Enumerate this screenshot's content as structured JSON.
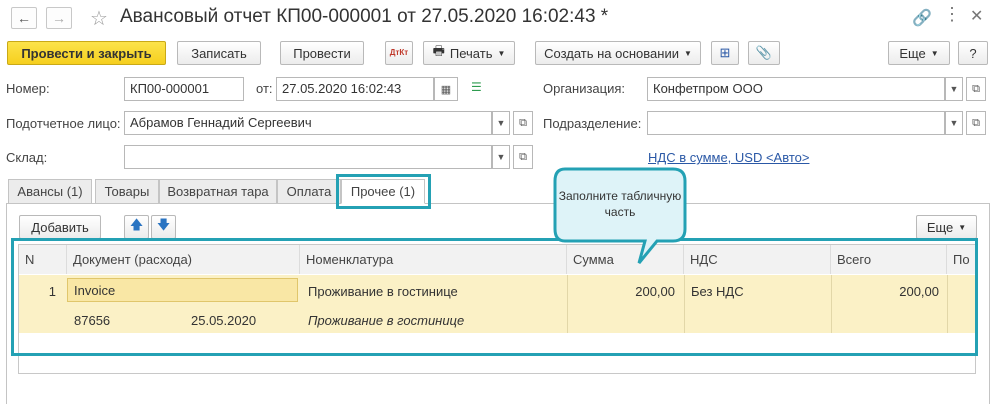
{
  "title": "Авансовый отчет КП00-000001 от 27.05.2020 16:02:43 *",
  "toolbar": {
    "post_close": "Провести и закрыть",
    "save": "Записать",
    "post": "Провести",
    "dt_kt": "ДтКт",
    "print": "Печать",
    "create_based": "Создать на основании",
    "more": "Еще",
    "help": "?"
  },
  "form": {
    "number_label": "Номер:",
    "number_value": "КП00-000001",
    "date_label": "от:",
    "date_value": "27.05.2020 16:02:43",
    "org_label": "Организация:",
    "org_value": "Конфетпром ООО",
    "person_label": "Подотчетное лицо:",
    "person_value": "Абрамов Геннадий Сергеевич",
    "dept_label": "Подразделение:",
    "dept_value": "",
    "warehouse_label": "Склад:",
    "warehouse_value": "",
    "vat_link": "НДС в сумме, USD <Авто>"
  },
  "tabs": [
    "Авансы (1)",
    "Товары",
    "Возвратная тара",
    "Оплата",
    "Прочее (1)"
  ],
  "tabs_active": "Прочее (1)",
  "table_toolbar": {
    "add": "Добавить",
    "more": "Еще"
  },
  "callout": "Заполните табличную часть",
  "table": {
    "headers": [
      "N",
      "Документ (расхода)",
      "Номенклатура",
      "Сумма",
      "НДС",
      "Всего",
      "По"
    ],
    "rows": [
      {
        "n": "1",
        "document": "Invoice",
        "doc_number": "87656",
        "doc_date": "25.05.2020",
        "nomenclature": "Проживание в гостинице",
        "content": "Проживание в гостинице",
        "amount": "200,00",
        "vat": "Без НДС",
        "total": "200,00"
      }
    ]
  },
  "colors": {
    "accent": "#24a1b4",
    "primary_button": "#f6cf1e",
    "row_highlight": "#fbf1c6",
    "link": "#2a58a6"
  }
}
